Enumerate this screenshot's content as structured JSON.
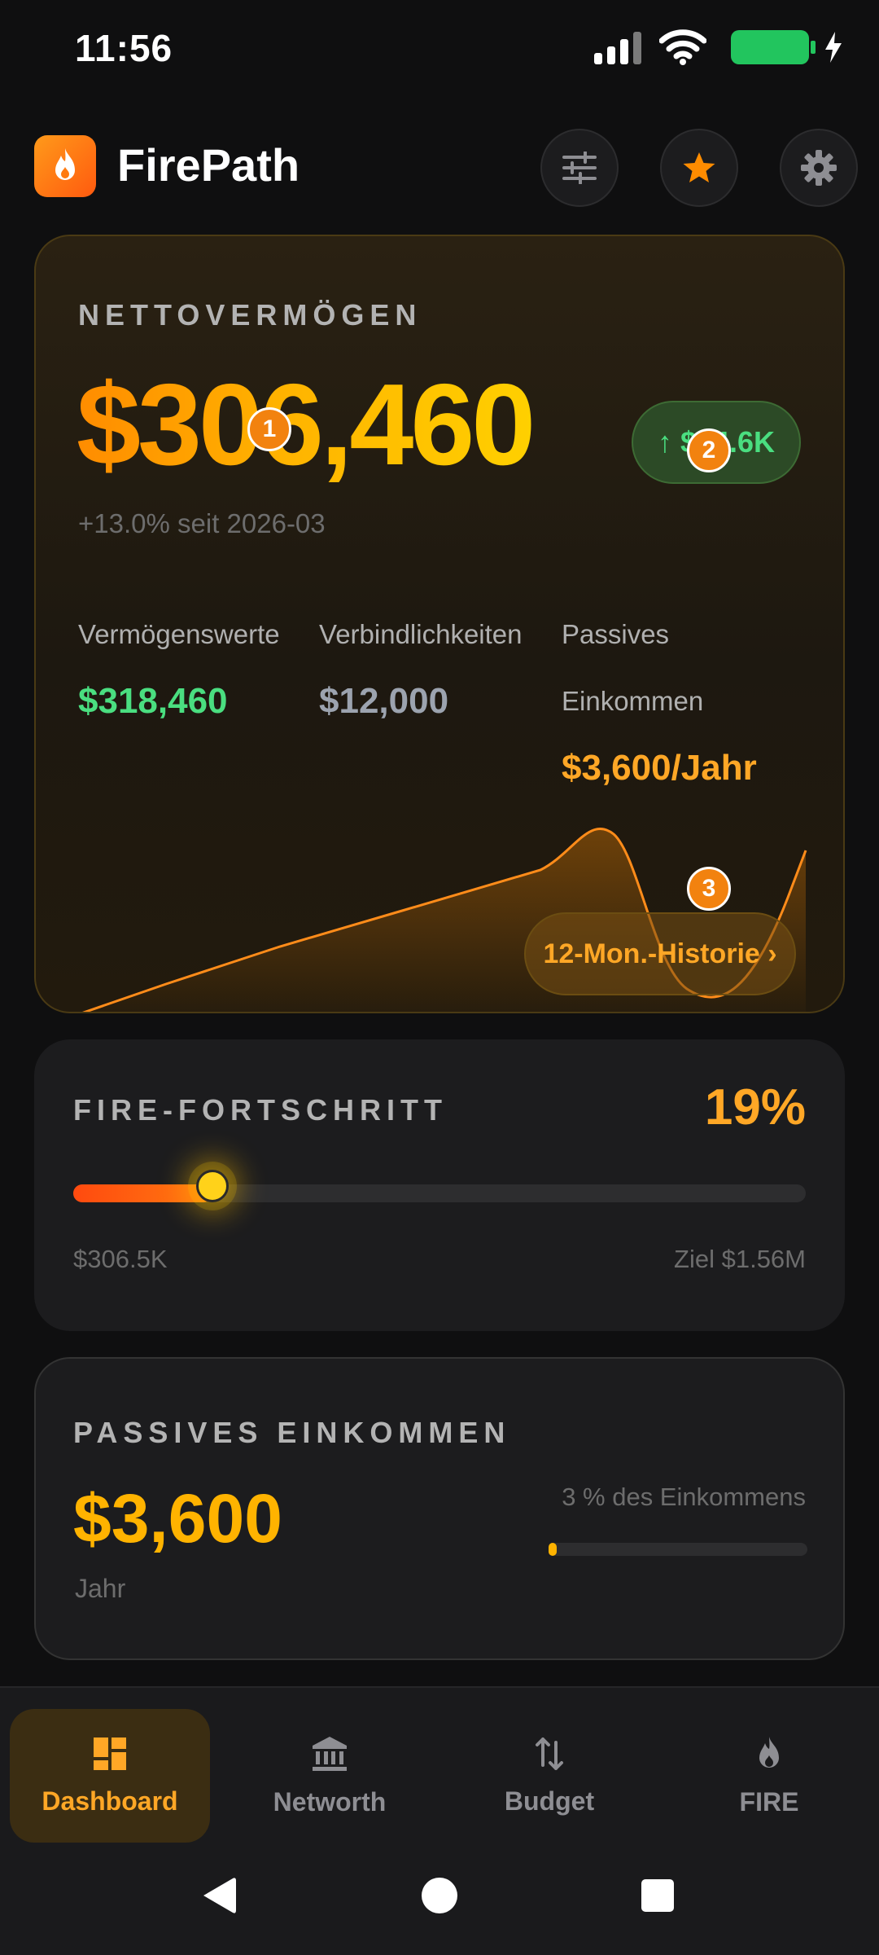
{
  "status_bar": {
    "time": "11:56"
  },
  "app": {
    "title": "FirePath"
  },
  "header_buttons": [
    "filter-icon",
    "star-icon",
    "gear-icon"
  ],
  "net_worth": {
    "label": "NETTOVERMÖGEN",
    "value": "$306,460",
    "delta_arrow": "↑",
    "delta_text": "$34.6K",
    "since": "+13.0% seit 2026-03",
    "assets_label": "Vermögenswerte",
    "assets_value": "$318,460",
    "liabilities_label": "Verbindlichkeiten",
    "liabilities_value": "$12,000",
    "passive_label_line1": "Passives",
    "passive_label_line2": "Einkommen",
    "passive_value": "$3,600/Jahr",
    "history_button": "12-Mon.-Historie ›"
  },
  "markers": [
    "1",
    "2",
    "3"
  ],
  "fire_progress": {
    "label": "FIRE-FORTSCHRITT",
    "percent_text": "19%",
    "progress": 0.19,
    "current": "$306.5K",
    "goal": "Ziel $1.56M"
  },
  "passive_income": {
    "label": "PASSIVES EINKOMMEN",
    "value": "$3,600",
    "period": "Jahr",
    "share_text": "3 % des Einkommens",
    "share": 0.03
  },
  "bottom_nav": [
    {
      "label": "Dashboard",
      "icon": "dashboard-icon",
      "active": true
    },
    {
      "label": "Networth",
      "icon": "bank-icon",
      "active": false
    },
    {
      "label": "Budget",
      "icon": "swap-vertical-icon",
      "active": false
    },
    {
      "label": "FIRE",
      "icon": "flame-icon",
      "active": false
    }
  ],
  "colors": {
    "accent": "#ffa726",
    "positive": "#4ade80",
    "background": "#0f0f10",
    "card": "#1c1c1e"
  }
}
